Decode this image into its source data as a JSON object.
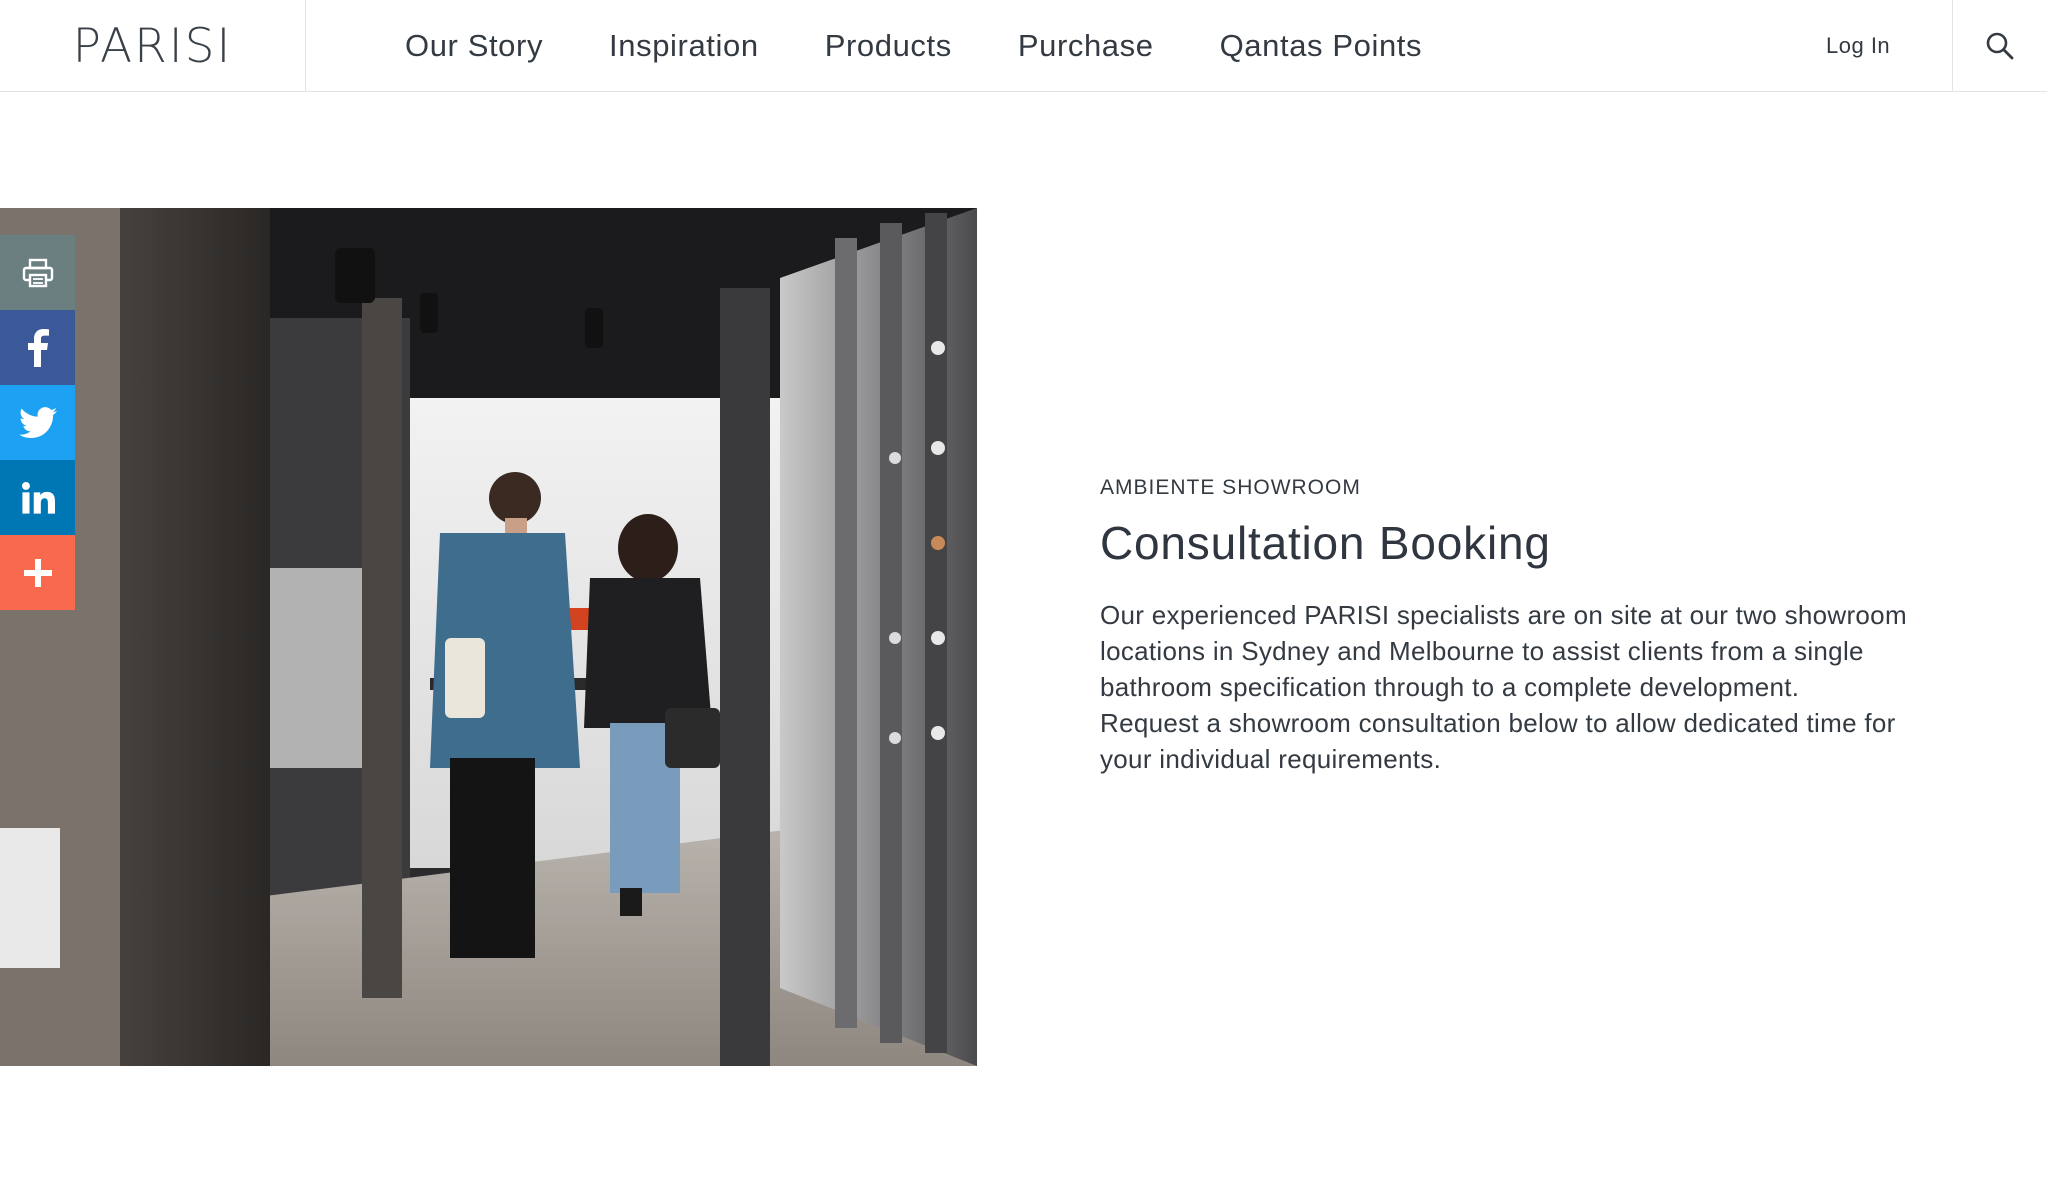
{
  "header": {
    "logo": "PARISI",
    "nav": [
      {
        "label": "Our Story"
      },
      {
        "label": "Inspiration"
      },
      {
        "label": "Products"
      },
      {
        "label": "Purchase"
      },
      {
        "label": "Qantas Points"
      }
    ],
    "login_label": "Log In",
    "search_icon": "search-icon"
  },
  "social": {
    "buttons": [
      {
        "icon": "print-icon",
        "color": "#6b7f80"
      },
      {
        "icon": "facebook-icon",
        "color": "#3b5998"
      },
      {
        "icon": "twitter-icon",
        "color": "#1da1f2"
      },
      {
        "icon": "linkedin-icon",
        "color": "#0077b5"
      },
      {
        "icon": "plus-icon",
        "color": "#f8694d"
      }
    ]
  },
  "hero": {
    "image_icon": "showroom-photo"
  },
  "content": {
    "eyebrow": "AMBIENTE SHOWROOM",
    "title": "Consultation Booking",
    "paragraph_1": "Our experienced PARISI specialists are on site at our two showroom locations in Sydney and Melbourne to assist clients from a single bathroom specification through to a complete development.",
    "paragraph_2": "Request a showroom consultation below to allow dedicated time for your individual requirements."
  }
}
